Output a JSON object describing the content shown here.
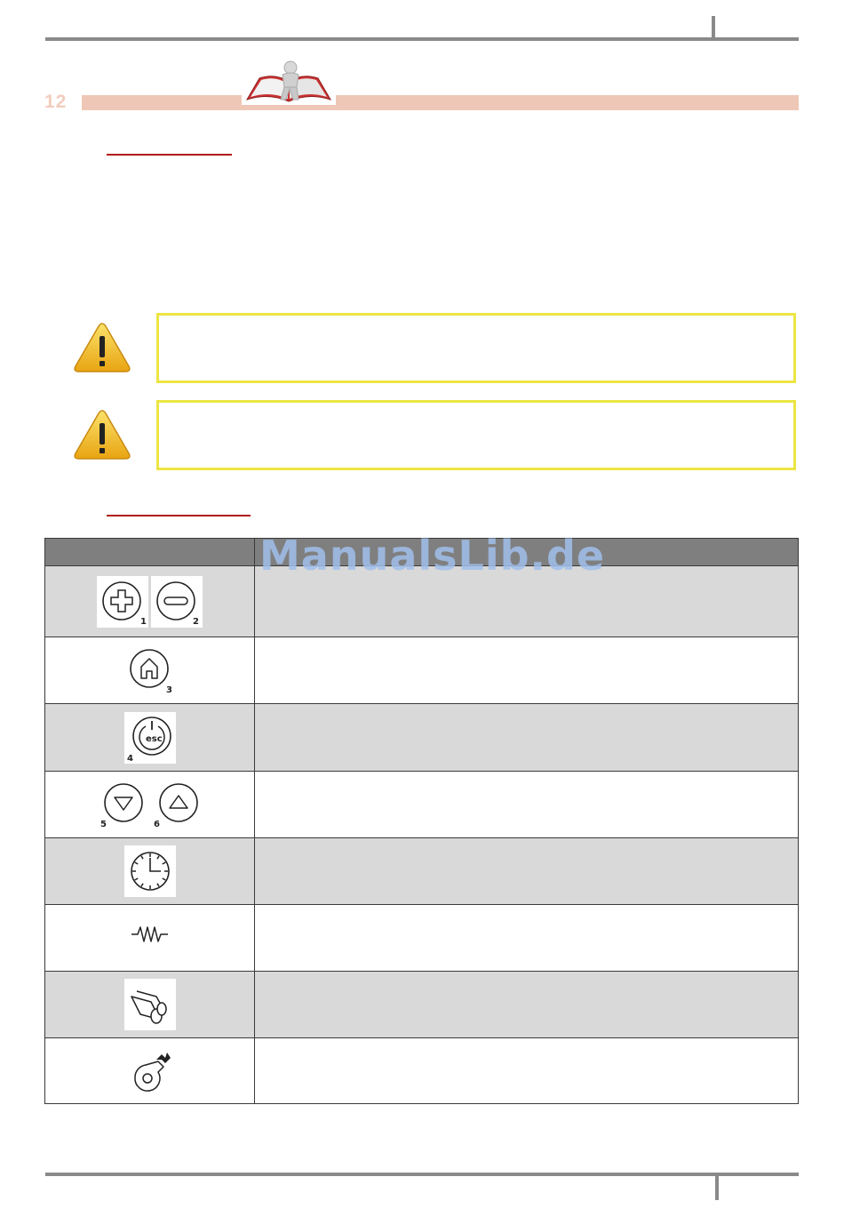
{
  "header": {
    "section_number": "12"
  },
  "watermark": "ManualsLib.de",
  "colors": {
    "rule": "#8a8a8a",
    "band": "#efc7b6",
    "heading_underline": "#b21a1a",
    "warning_border": "#ece542",
    "table_header": "#7f7f7f",
    "table_row_shaded": "#d9d9d9"
  },
  "warnings": [
    {
      "icon": "warning-triangle-icon"
    },
    {
      "icon": "warning-triangle-icon"
    }
  ],
  "table": {
    "rows": [
      {
        "icons": [
          "plus-circle-icon",
          "minus-circle-icon"
        ],
        "numbers": [
          "1",
          "2"
        ]
      },
      {
        "icons": [
          "home-icon"
        ],
        "numbers": [
          "3"
        ]
      },
      {
        "icons": [
          "power-esc-icon"
        ],
        "numbers": [
          "4"
        ],
        "esc_label": "esc"
      },
      {
        "icons": [
          "arrow-down-circle-icon",
          "arrow-up-circle-icon"
        ],
        "numbers": [
          "5",
          "6"
        ]
      },
      {
        "icons": [
          "clock-icon"
        ]
      },
      {
        "icons": [
          "resistor-icon"
        ]
      },
      {
        "icons": [
          "pellet-logs-icon"
        ]
      },
      {
        "icons": [
          "fan-blower-icon"
        ]
      }
    ]
  }
}
